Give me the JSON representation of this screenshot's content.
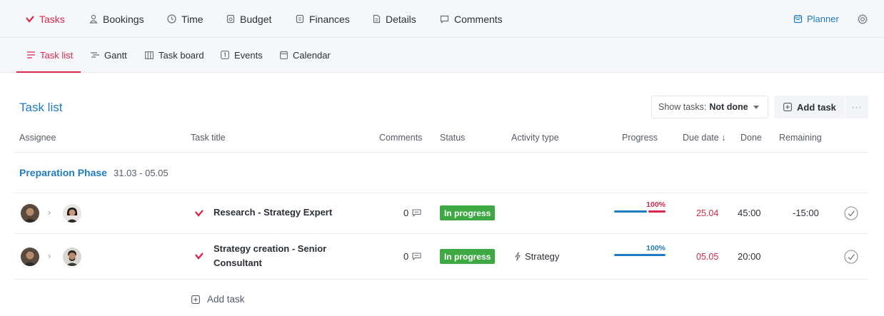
{
  "topnav": {
    "items": [
      {
        "label": "Tasks",
        "icon": "check-icon",
        "active": true
      },
      {
        "label": "Bookings",
        "icon": "person-icon"
      },
      {
        "label": "Time",
        "icon": "clock-icon"
      },
      {
        "label": "Budget",
        "icon": "budget-icon"
      },
      {
        "label": "Finances",
        "icon": "finances-icon"
      },
      {
        "label": "Details",
        "icon": "document-icon"
      },
      {
        "label": "Comments",
        "icon": "comment-icon"
      }
    ],
    "planner_label": "Planner"
  },
  "subnav": {
    "items": [
      {
        "label": "Task list",
        "icon": "list-icon",
        "active": true
      },
      {
        "label": "Gantt",
        "icon": "gantt-icon"
      },
      {
        "label": "Task board",
        "icon": "board-icon"
      },
      {
        "label": "Events",
        "icon": "events-icon"
      },
      {
        "label": "Calendar",
        "icon": "calendar-icon"
      }
    ]
  },
  "page": {
    "title": "Task list",
    "filter_prefix": "Show tasks:",
    "filter_value": "Not done",
    "add_task_label": "Add task",
    "more_label": "···"
  },
  "columns": {
    "assignee": "Assignee",
    "task_title": "Task title",
    "comments": "Comments",
    "status": "Status",
    "activity_type": "Activity type",
    "progress": "Progress",
    "due_date": "Due date ↓",
    "done": "Done",
    "remaining": "Remaining"
  },
  "phase": {
    "name": "Preparation Phase",
    "dates": "31.03 - 05.05"
  },
  "tasks": [
    {
      "title_line1": "Research - Strategy Expert",
      "title_line2": "",
      "comments": "0",
      "status": "In progress",
      "activity": "",
      "progress_label": "100%",
      "progress_fraction_blue": 0.65,
      "progress_over": true,
      "due": "25.04",
      "done": "45:00",
      "remaining": "-15:00"
    },
    {
      "title_line1": "Strategy creation - Senior",
      "title_line2": "Consultant",
      "comments": "0",
      "status": "In progress",
      "activity": "Strategy",
      "progress_label": "100%",
      "progress_fraction_blue": 1.0,
      "progress_over": false,
      "due": "05.05",
      "done": "20:00",
      "remaining": ""
    }
  ],
  "footer": {
    "add_task_label": "Add task"
  },
  "colors": {
    "accent_red": "#d8294a",
    "link_blue": "#1f7bc2",
    "status_green": "#3ea843",
    "progress_blue": "#1f7bc2"
  }
}
